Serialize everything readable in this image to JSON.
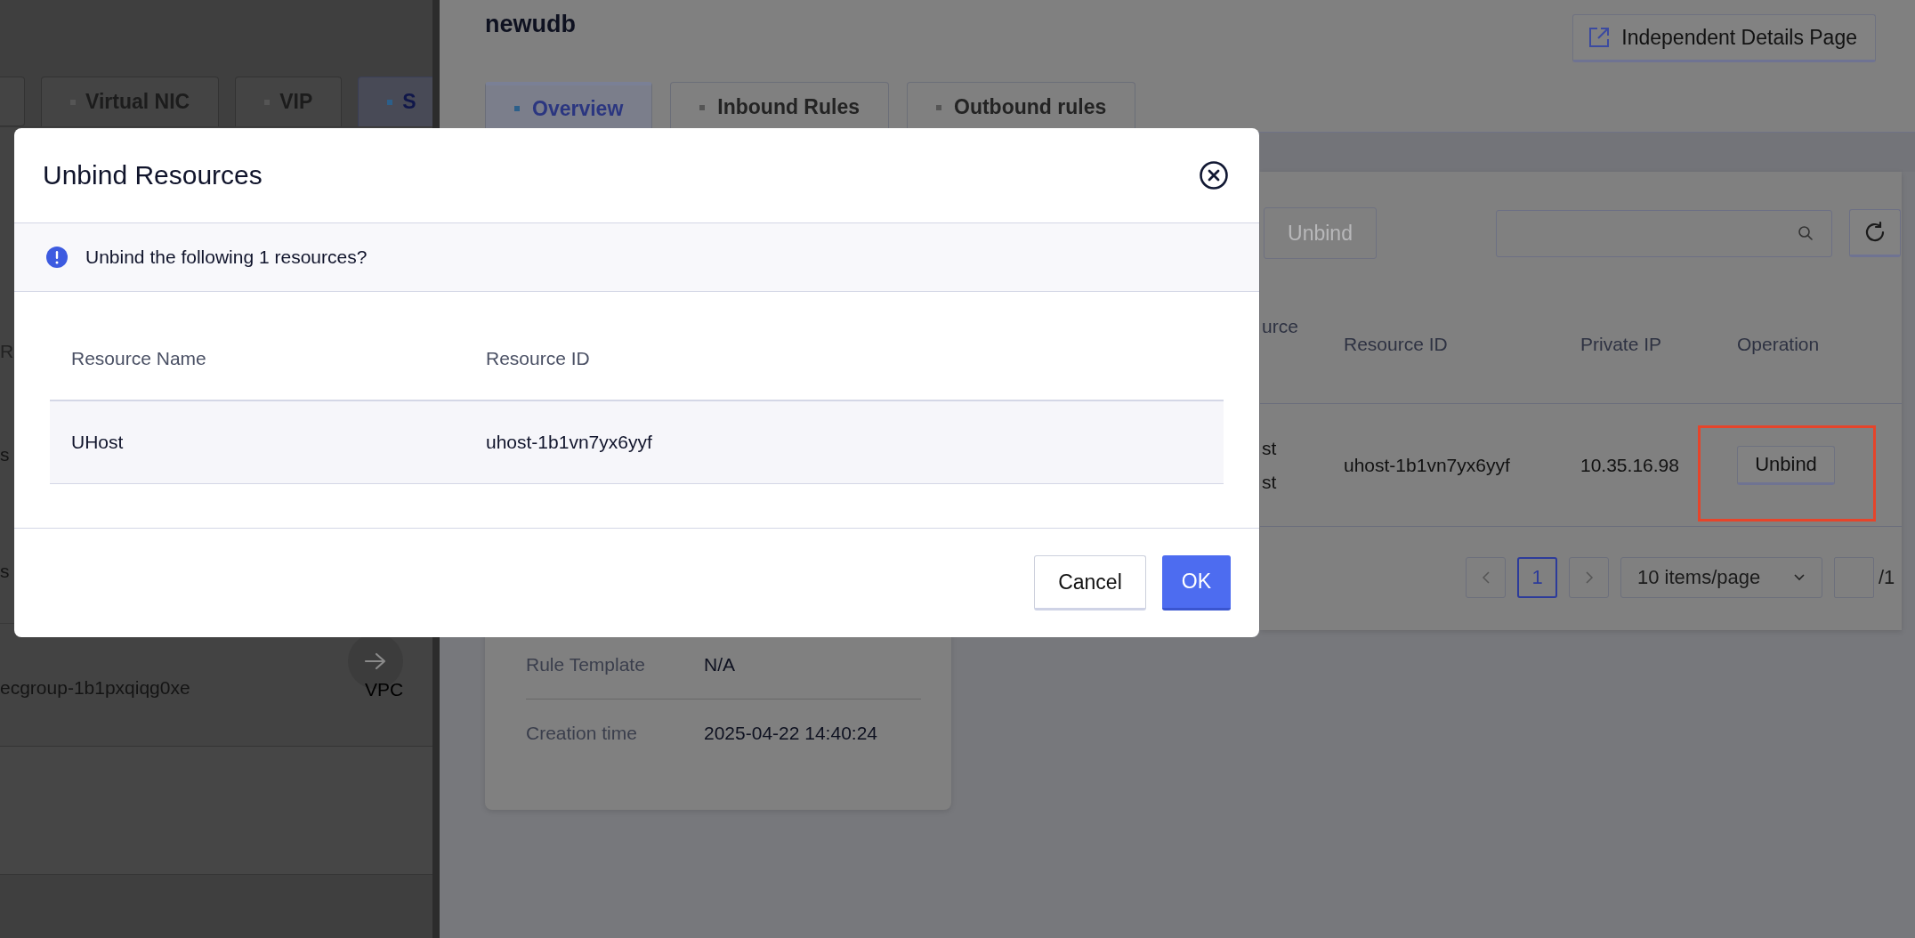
{
  "background_page": {
    "tabs": [
      {
        "label": "Virtual NIC",
        "selected": false
      },
      {
        "label": "VIP",
        "selected": false
      },
      {
        "label": "S",
        "selected": true
      }
    ],
    "column_fragments": [
      "R",
      "s",
      "s"
    ],
    "rows": [
      {
        "name": "ecgroup-1b1pxqiqg0xe",
        "vpc": "VPC"
      }
    ]
  },
  "drawer": {
    "title": "newudb",
    "details_button": "Independent Details Page",
    "tabs": [
      {
        "label": "Overview",
        "selected": true
      },
      {
        "label": "Inbound Rules",
        "selected": false
      },
      {
        "label": "Outbound rules",
        "selected": false
      }
    ],
    "info": [
      {
        "label": "Rule Template",
        "value": "N/A"
      },
      {
        "label": "Creation time",
        "value": "2025-04-22 14:40:24"
      }
    ],
    "unbind_button": {
      "label": "Unbind",
      "disabled": true
    },
    "table": {
      "columns": [
        "urce",
        "Resource ID",
        "Private IP",
        "Operation"
      ],
      "rows": [
        {
          "column_1": [
            "st",
            "st"
          ],
          "resource_id": "uhost-1b1vn7yx6yyf",
          "private_ip": "10.35.16.98",
          "operation": "Unbind",
          "highlighted": true
        }
      ]
    },
    "pagination": {
      "pages": [
        {
          "label": "1",
          "selected": true
        }
      ],
      "page_size": "10 items/page",
      "total": "/1"
    }
  },
  "dialog": {
    "title": "Unbind Resources",
    "message": "Unbind the following 1 resources?",
    "columns": [
      "Resource Name",
      "Resource ID"
    ],
    "rows": [
      {
        "name": "UHost",
        "id": "uhost-1b1vn7yx6yyf"
      }
    ],
    "buttons": [
      {
        "label": "Cancel",
        "kind": "secondary"
      },
      {
        "label": "OK",
        "kind": "primary"
      }
    ]
  }
}
